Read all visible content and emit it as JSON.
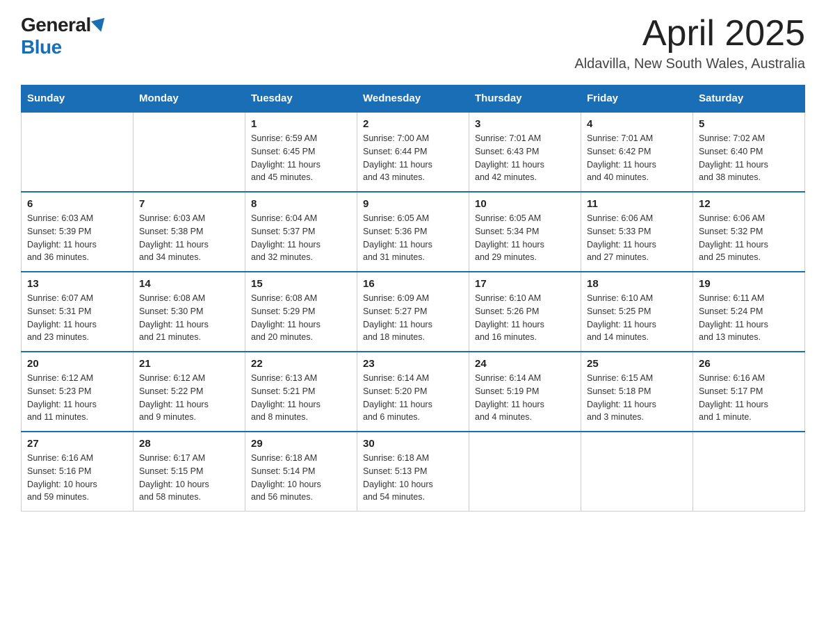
{
  "header": {
    "logo_general": "General",
    "logo_blue": "Blue",
    "title": "April 2025",
    "subtitle": "Aldavilla, New South Wales, Australia"
  },
  "days_of_week": [
    "Sunday",
    "Monday",
    "Tuesday",
    "Wednesday",
    "Thursday",
    "Friday",
    "Saturday"
  ],
  "weeks": [
    [
      {
        "day": "",
        "info": ""
      },
      {
        "day": "",
        "info": ""
      },
      {
        "day": "1",
        "info": "Sunrise: 6:59 AM\nSunset: 6:45 PM\nDaylight: 11 hours\nand 45 minutes."
      },
      {
        "day": "2",
        "info": "Sunrise: 7:00 AM\nSunset: 6:44 PM\nDaylight: 11 hours\nand 43 minutes."
      },
      {
        "day": "3",
        "info": "Sunrise: 7:01 AM\nSunset: 6:43 PM\nDaylight: 11 hours\nand 42 minutes."
      },
      {
        "day": "4",
        "info": "Sunrise: 7:01 AM\nSunset: 6:42 PM\nDaylight: 11 hours\nand 40 minutes."
      },
      {
        "day": "5",
        "info": "Sunrise: 7:02 AM\nSunset: 6:40 PM\nDaylight: 11 hours\nand 38 minutes."
      }
    ],
    [
      {
        "day": "6",
        "info": "Sunrise: 6:03 AM\nSunset: 5:39 PM\nDaylight: 11 hours\nand 36 minutes."
      },
      {
        "day": "7",
        "info": "Sunrise: 6:03 AM\nSunset: 5:38 PM\nDaylight: 11 hours\nand 34 minutes."
      },
      {
        "day": "8",
        "info": "Sunrise: 6:04 AM\nSunset: 5:37 PM\nDaylight: 11 hours\nand 32 minutes."
      },
      {
        "day": "9",
        "info": "Sunrise: 6:05 AM\nSunset: 5:36 PM\nDaylight: 11 hours\nand 31 minutes."
      },
      {
        "day": "10",
        "info": "Sunrise: 6:05 AM\nSunset: 5:34 PM\nDaylight: 11 hours\nand 29 minutes."
      },
      {
        "day": "11",
        "info": "Sunrise: 6:06 AM\nSunset: 5:33 PM\nDaylight: 11 hours\nand 27 minutes."
      },
      {
        "day": "12",
        "info": "Sunrise: 6:06 AM\nSunset: 5:32 PM\nDaylight: 11 hours\nand 25 minutes."
      }
    ],
    [
      {
        "day": "13",
        "info": "Sunrise: 6:07 AM\nSunset: 5:31 PM\nDaylight: 11 hours\nand 23 minutes."
      },
      {
        "day": "14",
        "info": "Sunrise: 6:08 AM\nSunset: 5:30 PM\nDaylight: 11 hours\nand 21 minutes."
      },
      {
        "day": "15",
        "info": "Sunrise: 6:08 AM\nSunset: 5:29 PM\nDaylight: 11 hours\nand 20 minutes."
      },
      {
        "day": "16",
        "info": "Sunrise: 6:09 AM\nSunset: 5:27 PM\nDaylight: 11 hours\nand 18 minutes."
      },
      {
        "day": "17",
        "info": "Sunrise: 6:10 AM\nSunset: 5:26 PM\nDaylight: 11 hours\nand 16 minutes."
      },
      {
        "day": "18",
        "info": "Sunrise: 6:10 AM\nSunset: 5:25 PM\nDaylight: 11 hours\nand 14 minutes."
      },
      {
        "day": "19",
        "info": "Sunrise: 6:11 AM\nSunset: 5:24 PM\nDaylight: 11 hours\nand 13 minutes."
      }
    ],
    [
      {
        "day": "20",
        "info": "Sunrise: 6:12 AM\nSunset: 5:23 PM\nDaylight: 11 hours\nand 11 minutes."
      },
      {
        "day": "21",
        "info": "Sunrise: 6:12 AM\nSunset: 5:22 PM\nDaylight: 11 hours\nand 9 minutes."
      },
      {
        "day": "22",
        "info": "Sunrise: 6:13 AM\nSunset: 5:21 PM\nDaylight: 11 hours\nand 8 minutes."
      },
      {
        "day": "23",
        "info": "Sunrise: 6:14 AM\nSunset: 5:20 PM\nDaylight: 11 hours\nand 6 minutes."
      },
      {
        "day": "24",
        "info": "Sunrise: 6:14 AM\nSunset: 5:19 PM\nDaylight: 11 hours\nand 4 minutes."
      },
      {
        "day": "25",
        "info": "Sunrise: 6:15 AM\nSunset: 5:18 PM\nDaylight: 11 hours\nand 3 minutes."
      },
      {
        "day": "26",
        "info": "Sunrise: 6:16 AM\nSunset: 5:17 PM\nDaylight: 11 hours\nand 1 minute."
      }
    ],
    [
      {
        "day": "27",
        "info": "Sunrise: 6:16 AM\nSunset: 5:16 PM\nDaylight: 10 hours\nand 59 minutes."
      },
      {
        "day": "28",
        "info": "Sunrise: 6:17 AM\nSunset: 5:15 PM\nDaylight: 10 hours\nand 58 minutes."
      },
      {
        "day": "29",
        "info": "Sunrise: 6:18 AM\nSunset: 5:14 PM\nDaylight: 10 hours\nand 56 minutes."
      },
      {
        "day": "30",
        "info": "Sunrise: 6:18 AM\nSunset: 5:13 PM\nDaylight: 10 hours\nand 54 minutes."
      },
      {
        "day": "",
        "info": ""
      },
      {
        "day": "",
        "info": ""
      },
      {
        "day": "",
        "info": ""
      }
    ]
  ]
}
